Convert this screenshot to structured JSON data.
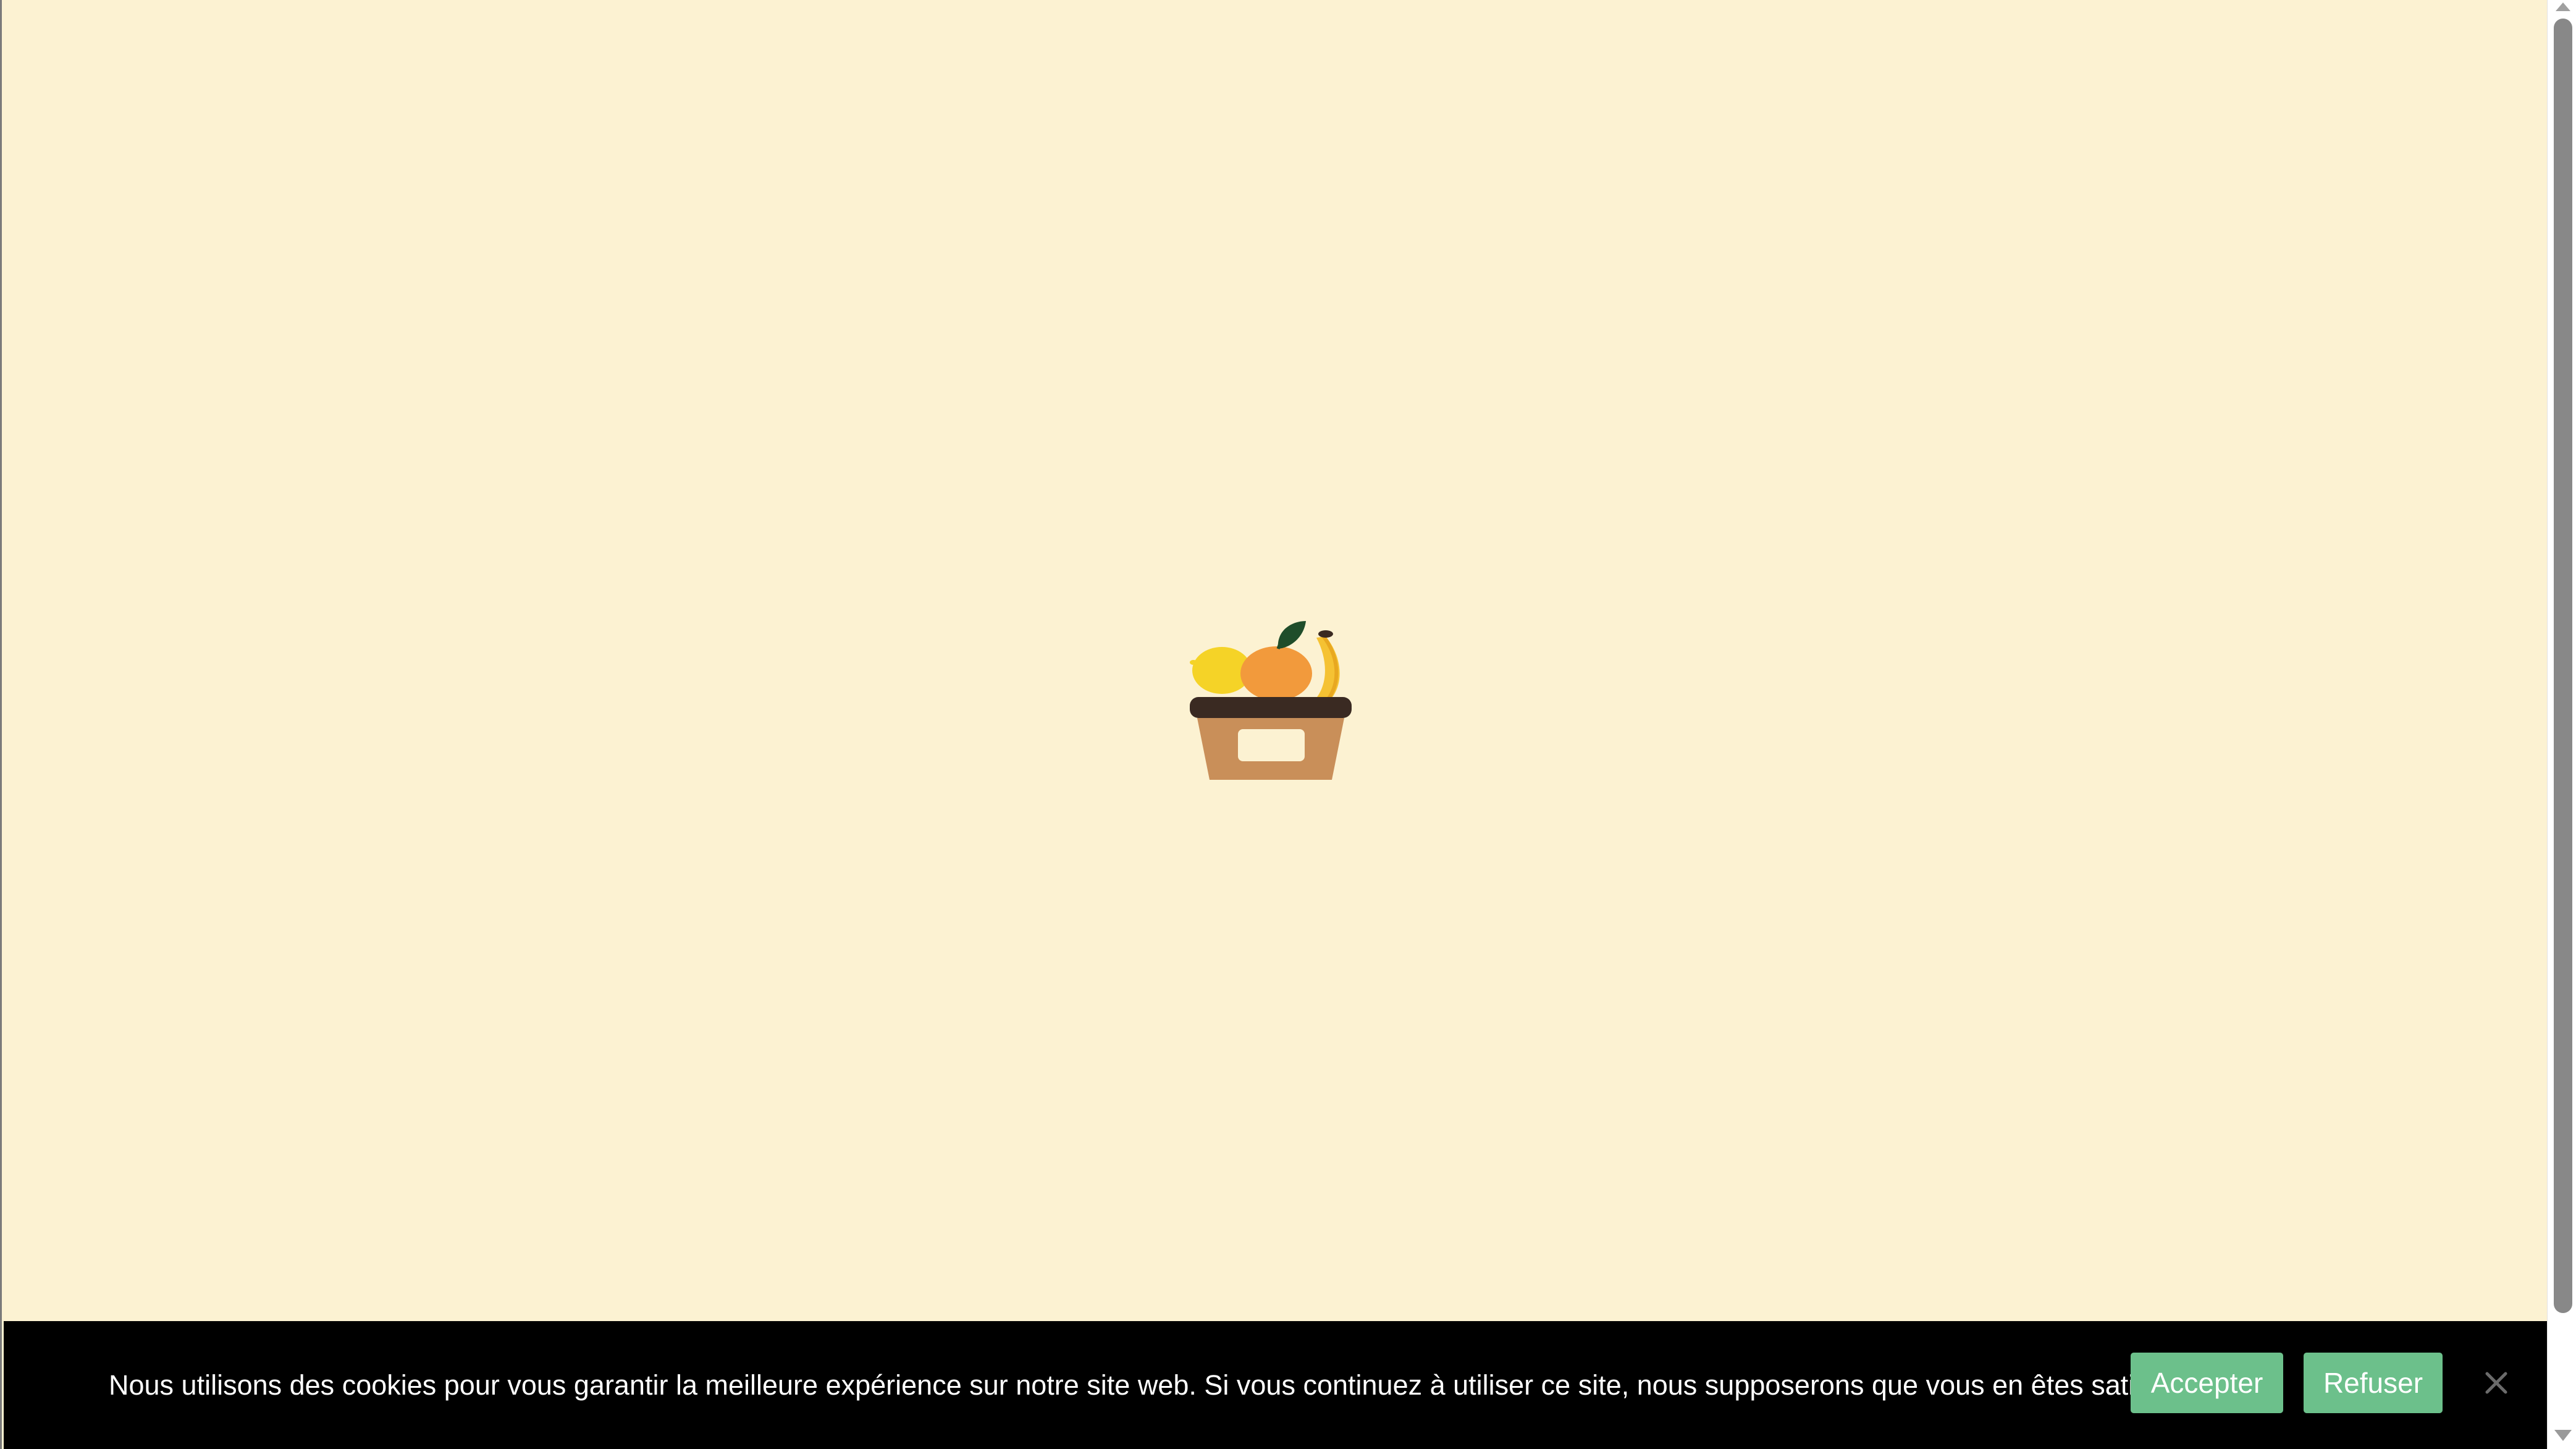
{
  "page": {
    "background_color": "#fcf2d2"
  },
  "loader": {
    "icon": "fruit-basket-icon"
  },
  "cookie_banner": {
    "message": "Nous utilisons des cookies pour vous garantir la meilleure expérience sur notre site web. Si vous continuez à utiliser ce site, nous supposerons que vous en êtes satisfait.",
    "accept_label": "Accepter",
    "refuse_label": "Refuser",
    "close_icon": "close-icon",
    "background_color": "#000000",
    "button_color": "#6cc08b"
  },
  "scrollbar": {
    "up_icon": "scroll-up-arrow-icon",
    "down_icon": "scroll-down-arrow-icon"
  }
}
